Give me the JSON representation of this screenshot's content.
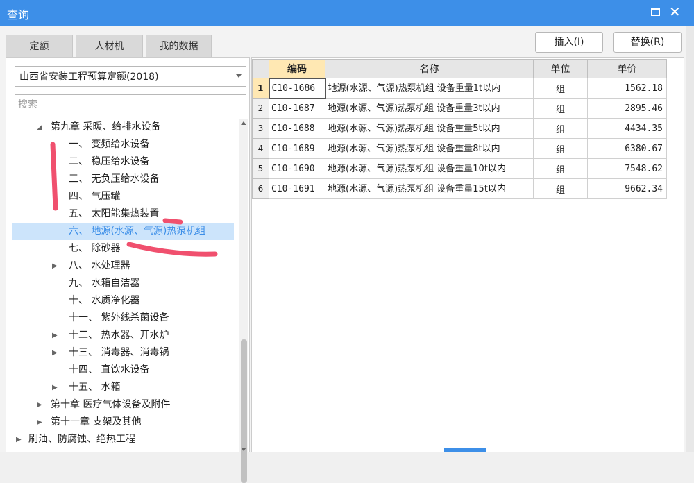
{
  "window": {
    "title": "查询"
  },
  "tabs": [
    {
      "label": "定额",
      "active": true
    },
    {
      "label": "人材机",
      "active": false
    },
    {
      "label": "我的数据",
      "active": false
    }
  ],
  "toolbar": {
    "insert_label": "插入(I)",
    "replace_label": "替换(R)"
  },
  "quota_select": {
    "value": "山西省安装工程预算定额(2018)"
  },
  "search": {
    "placeholder": "搜索"
  },
  "tree": [
    {
      "label": "第九章 采暖、给排水设备",
      "level": 1,
      "arrow": "expanded",
      "selected": false
    },
    {
      "label": "一、 变频给水设备",
      "level": 2,
      "arrow": "none",
      "selected": false
    },
    {
      "label": "二、 稳压给水设备",
      "level": 2,
      "arrow": "none",
      "selected": false
    },
    {
      "label": "三、 无负压给水设备",
      "level": 2,
      "arrow": "none",
      "selected": false
    },
    {
      "label": "四、 气压罐",
      "level": 2,
      "arrow": "none",
      "selected": false
    },
    {
      "label": "五、 太阳能集热装置",
      "level": 2,
      "arrow": "none",
      "selected": false
    },
    {
      "label": "六、 地源(水源、气源)热泵机组",
      "level": 2,
      "arrow": "none",
      "selected": true
    },
    {
      "label": "七、 除砂器",
      "level": 2,
      "arrow": "none",
      "selected": false
    },
    {
      "label": "八、 水处理器",
      "level": 2,
      "arrow": "collapsed",
      "selected": false
    },
    {
      "label": "九、 水箱自洁器",
      "level": 2,
      "arrow": "none",
      "selected": false
    },
    {
      "label": "十、 水质净化器",
      "level": 2,
      "arrow": "none",
      "selected": false
    },
    {
      "label": "十一、 紫外线杀菌设备",
      "level": 2,
      "arrow": "none",
      "selected": false
    },
    {
      "label": "十二、 热水器、开水炉",
      "level": 2,
      "arrow": "collapsed",
      "selected": false
    },
    {
      "label": "十三、 消毒器、消毒锅",
      "level": 2,
      "arrow": "collapsed",
      "selected": false
    },
    {
      "label": "十四、 直饮水设备",
      "level": 2,
      "arrow": "none",
      "selected": false
    },
    {
      "label": "十五、 水箱",
      "level": 2,
      "arrow": "collapsed",
      "selected": false
    },
    {
      "label": "第十章 医疗气体设备及附件",
      "level": 1,
      "arrow": "collapsed",
      "selected": false
    },
    {
      "label": "第十一章 支架及其他",
      "level": 1,
      "arrow": "collapsed",
      "selected": false
    },
    {
      "label": "刷油、防腐蚀、绝热工程",
      "level": 0,
      "arrow": "collapsed",
      "selected": false
    }
  ],
  "table": {
    "headers": {
      "code": "编码",
      "name": "名称",
      "unit": "单位",
      "price": "单价"
    },
    "rows": [
      {
        "idx": "1",
        "code": "C10-1686",
        "name": "地源(水源、气源)热泵机组 设备重量1t以内",
        "unit": "组",
        "price": "1562.18"
      },
      {
        "idx": "2",
        "code": "C10-1687",
        "name": "地源(水源、气源)热泵机组 设备重量3t以内",
        "unit": "组",
        "price": "2895.46"
      },
      {
        "idx": "3",
        "code": "C10-1688",
        "name": "地源(水源、气源)热泵机组 设备重量5t以内",
        "unit": "组",
        "price": "4434.35"
      },
      {
        "idx": "4",
        "code": "C10-1689",
        "name": "地源(水源、气源)热泵机组 设备重量8t以内",
        "unit": "组",
        "price": "6380.67"
      },
      {
        "idx": "5",
        "code": "C10-1690",
        "name": "地源(水源、气源)热泵机组 设备重量10t以内",
        "unit": "组",
        "price": "7548.62"
      },
      {
        "idx": "6",
        "code": "C10-1691",
        "name": "地源(水源、气源)热泵机组 设备重量15t以内",
        "unit": "组",
        "price": "9662.34"
      }
    ]
  },
  "colors": {
    "accent": "#3d8fe8",
    "selected_bg": "#cce4fb",
    "header_highlight": "#ffe8b3",
    "annotation": "#f0506e"
  }
}
